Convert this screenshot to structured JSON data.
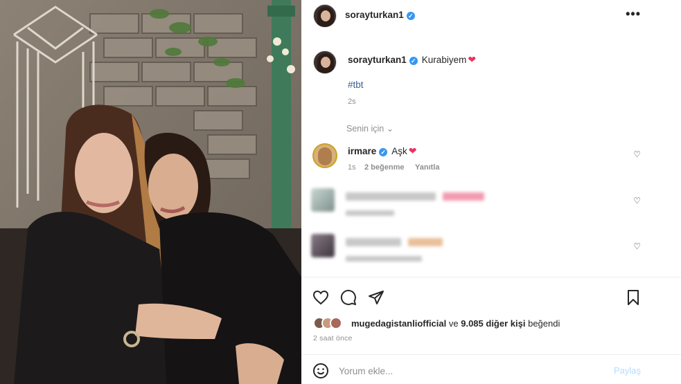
{
  "post": {
    "username": "sorayturkan1",
    "caption": "Kurabiyem",
    "hashtag": "#tbt",
    "caption_age": "2s",
    "for_you_label": "Senin için"
  },
  "comments": [
    {
      "username": "irmare",
      "text": "Aşk",
      "age": "1s",
      "likes": "2 beğenme",
      "reply": "Yanıtla"
    }
  ],
  "likes": {
    "user": "mugedagistanliofficial",
    "connector": "ve",
    "others": "9.085 diğer kişi",
    "suffix": "beğendi"
  },
  "timestamp": "2 saat önce",
  "comment_box": {
    "placeholder": "Yorum ekle...",
    "post_label": "Paylaş"
  },
  "colors": {
    "verified": "#3897f0",
    "heart": "#e8355e",
    "hashtag": "#3b5f95",
    "post_disabled": "#b3dbff"
  },
  "icons": [
    "more-icon",
    "heart-icon",
    "comment-icon",
    "share-icon",
    "bookmark-icon",
    "emoji-icon",
    "verified-icon"
  ]
}
